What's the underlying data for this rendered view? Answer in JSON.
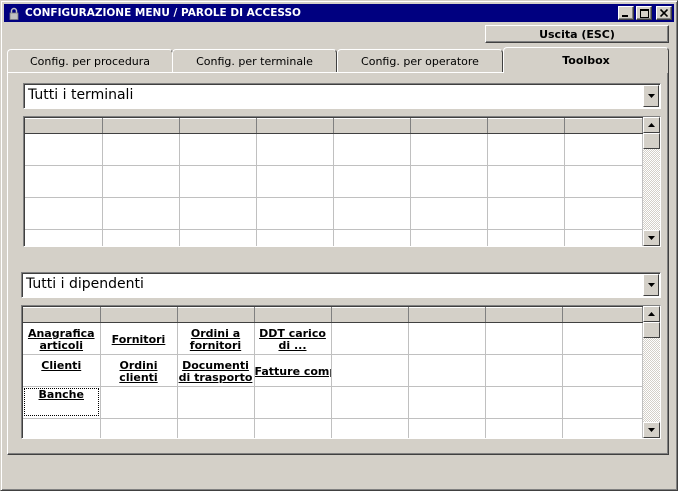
{
  "window": {
    "title": "CONFIGURAZIONE MENU / PAROLE DI ACCESSO",
    "minimize_glyph": "_",
    "maximize_glyph": "□",
    "close_glyph": "×",
    "icon": "lock-icon"
  },
  "toolbar": {
    "exit_label": "Uscita (ESC)"
  },
  "tabs": [
    {
      "label": "Config. per procedura",
      "active": false
    },
    {
      "label": "Config. per terminale",
      "active": false
    },
    {
      "label": "Config. per operatore",
      "active": false
    },
    {
      "label": "Toolbox",
      "active": true
    }
  ],
  "terminals": {
    "selected": "Tutti i terminali"
  },
  "employees": {
    "selected": "Tutti i dipendenti",
    "rows": [
      [
        {
          "text": "Anagrafica articoli"
        },
        {
          "text": "Fornitori"
        },
        {
          "text": "Ordini a fornitori"
        },
        {
          "text": "DDT carico di ..."
        }
      ],
      [
        {
          "text": "Clienti"
        },
        {
          "text": "Ordini clienti"
        },
        {
          "text": "Documenti di trasporto"
        },
        {
          "text": "Fatture compagnatori"
        }
      ],
      [
        {
          "text": "Banche"
        }
      ]
    ]
  }
}
